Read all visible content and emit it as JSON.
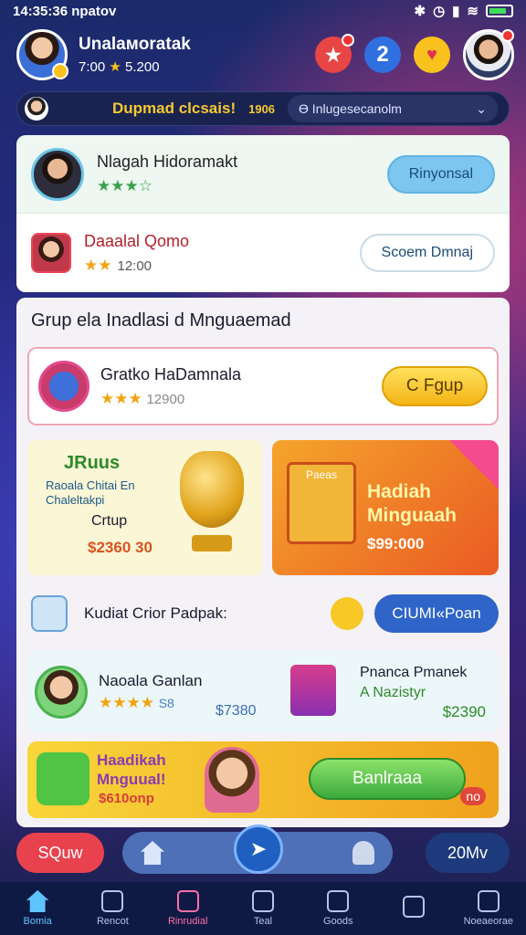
{
  "status": {
    "time": "14:35:36",
    "carrier": "npatov"
  },
  "header": {
    "user_name": "Unalaмoratak",
    "coins": "7:00",
    "stars": "5.200",
    "badge_number": "2"
  },
  "banner": {
    "title": "Dupmad clcsais!",
    "count": "1906",
    "select_value": "Ө Inlugesecanolm"
  },
  "friends": [
    {
      "name": "Nlagah Hidoramakt",
      "stars": "★★★☆",
      "action": "Rinyonsal"
    },
    {
      "name": "Daaalal Qomo",
      "stars": "★★",
      "value": "12:00",
      "action": "Scoem Dmnaj"
    }
  ],
  "group": {
    "title": "Grup ela Inadlasi d Mnguaemad",
    "item": {
      "name": "Gratko HaDamnala",
      "stars": "★★★",
      "value": "12900",
      "action": "C Fgup"
    }
  },
  "promo_left": {
    "title": "JRuus",
    "subtitle": "Raoala Chitai En Chaleltakpi",
    "cta": "Crtup",
    "price": "$2360 30"
  },
  "promo_right": {
    "title_line1": "Hadiah",
    "title_line2": "Minguaah",
    "price": "$99:000",
    "board_label": "Paeas"
  },
  "invite": {
    "label": "Kudiat Crior Padpak:",
    "button": "CIUMI«Poan"
  },
  "shop": {
    "left_name": "Naoala Ganlan",
    "left_stars": "★★★★",
    "left_value": "S8",
    "left_price": "$7380",
    "right_name": "Pnanca Pmanek",
    "right_sub": "A Nazistyr",
    "right_price": "$2390"
  },
  "bottom_promo": {
    "title_line1": "Haadikah",
    "title_line2": "Mnguual!",
    "price": "$610onp",
    "button": "Banlraaa",
    "tag": "no"
  },
  "action_bar": {
    "left": "SQuw",
    "right": "20Mv"
  },
  "tabs": [
    {
      "label": "Bomia"
    },
    {
      "label": "Rencot"
    },
    {
      "label": "Rinrudial"
    },
    {
      "label": "Teal"
    },
    {
      "label": "Goods"
    },
    {
      "label": ""
    },
    {
      "label": "Noeaeorae"
    }
  ]
}
